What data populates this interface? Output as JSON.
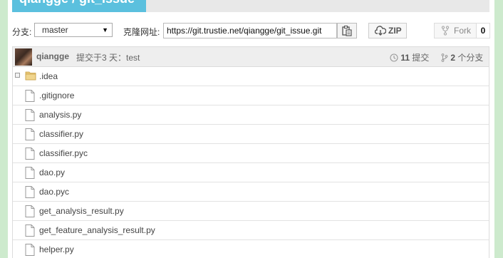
{
  "repo": {
    "title": "qiangge / git_issue"
  },
  "toolbar": {
    "branch_label": "分支:",
    "branch_selected": "master",
    "clone_label": "克隆网址:",
    "clone_url": "https://git.trustie.net/qiangge/git_issue.git",
    "zip_label": "ZIP",
    "fork_label": "Fork",
    "fork_count": "0"
  },
  "commit": {
    "user": "qiangge",
    "message": "提交于3 天：test",
    "commits_count": "11",
    "commits_label": "提交",
    "branches_count": "2",
    "branches_label": "个分支"
  },
  "files": [
    {
      "name": ".idea",
      "type": "folder"
    },
    {
      "name": ".gitignore",
      "type": "file"
    },
    {
      "name": "analysis.py",
      "type": "file"
    },
    {
      "name": "classifier.py",
      "type": "file"
    },
    {
      "name": "classifier.pyc",
      "type": "file"
    },
    {
      "name": "dao.py",
      "type": "file"
    },
    {
      "name": "dao.pyc",
      "type": "file"
    },
    {
      "name": "get_analysis_result.py",
      "type": "file"
    },
    {
      "name": "get_feature_analysis_result.py",
      "type": "file"
    },
    {
      "name": "helper.py",
      "type": "file"
    }
  ],
  "colors": {
    "page_bg": "#cdeacd",
    "title_tab": "#5bc0de",
    "folder": "#e8c676"
  }
}
